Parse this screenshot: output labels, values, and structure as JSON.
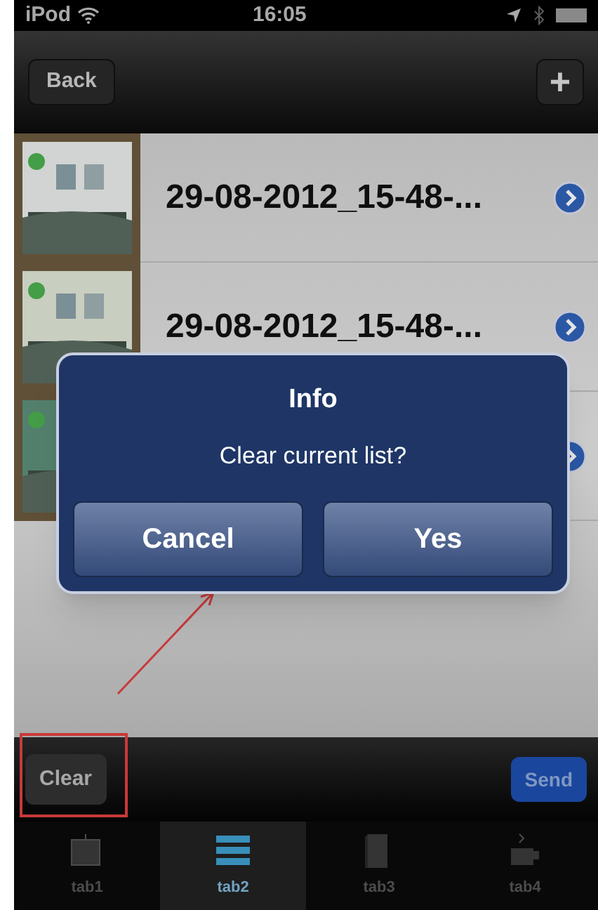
{
  "status_bar": {
    "carrier": "iPod",
    "time": "16:05"
  },
  "nav_bar": {
    "back": "Back",
    "add": "+"
  },
  "rows": [
    {
      "title": "29-08-2012_15-48-..."
    },
    {
      "title": "29-08-2012_15-48-..."
    },
    {
      "covered": true
    }
  ],
  "dialog": {
    "title": "Info",
    "message": "Clear current list?",
    "buttons": [
      "Cancel",
      "Yes"
    ]
  },
  "toolbar": {
    "clear": "Clear",
    "send": "Send",
    "clear_highlighted": true
  },
  "tabs": [
    {
      "label": "tab1",
      "selected": false,
      "kind": "tv"
    },
    {
      "label": "tab2",
      "selected": true,
      "kind": "list"
    },
    {
      "label": "tab3",
      "selected": false,
      "kind": "book"
    },
    {
      "label": "tab4",
      "selected": false,
      "kind": "cup"
    }
  ]
}
